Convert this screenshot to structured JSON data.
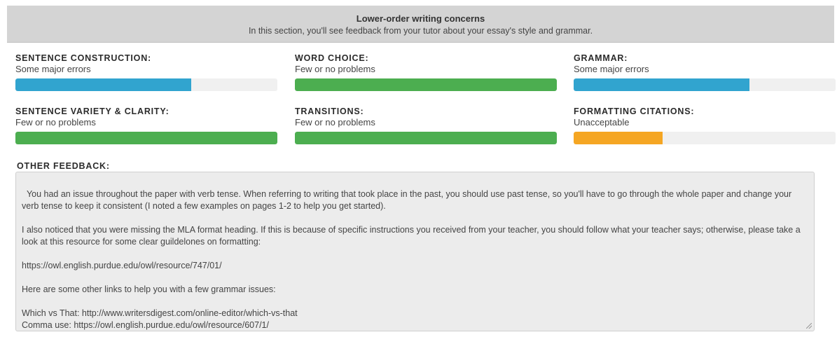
{
  "header": {
    "title": "Lower-order writing concerns",
    "subtitle": "In this section, you'll see feedback from your tutor about your essay's style and grammar."
  },
  "colors": {
    "blue": "#31a4cf",
    "green": "#4cae50",
    "orange": "#f5a623"
  },
  "metrics": [
    {
      "label": "SENTENCE CONSTRUCTION:",
      "value": "Some major errors",
      "level": 0.67,
      "color": "blue"
    },
    {
      "label": "WORD CHOICE:",
      "value": "Few or no problems",
      "level": 1.0,
      "color": "green"
    },
    {
      "label": "GRAMMAR:",
      "value": "Some major errors",
      "level": 0.67,
      "color": "blue"
    },
    {
      "label": "SENTENCE VARIETY & CLARITY:",
      "value": "Few or no problems",
      "level": 1.0,
      "color": "green"
    },
    {
      "label": "TRANSITIONS:",
      "value": "Few or no problems",
      "level": 1.0,
      "color": "green"
    },
    {
      "label": "FORMATTING CITATIONS:",
      "value": "Unacceptable",
      "level": 0.34,
      "color": "orange"
    }
  ],
  "feedback": {
    "label": "OTHER FEEDBACK:",
    "text": "You had an issue throughout the paper with verb tense. When referring to writing that took place in the past, you should use past tense, so you'll have to go through the whole paper and change your verb tense to keep it consistent (I noted a few examples on pages 1-2 to help you get started).\n\nI also noticed that you were missing the MLA format heading. If this is because of specific instructions you received from your teacher, you should follow what your teacher says; otherwise, please take a look at this resource for some clear guildelones on formatting:\n\nhttps://owl.english.purdue.edu/owl/resource/747/01/\n\nHere are some other links to help you with a few grammar issues:\n\nWhich vs That: http://www.writersdigest.com/online-editor/which-vs-that\nComma use: https://owl.english.purdue.edu/owl/resource/607/1/"
  }
}
